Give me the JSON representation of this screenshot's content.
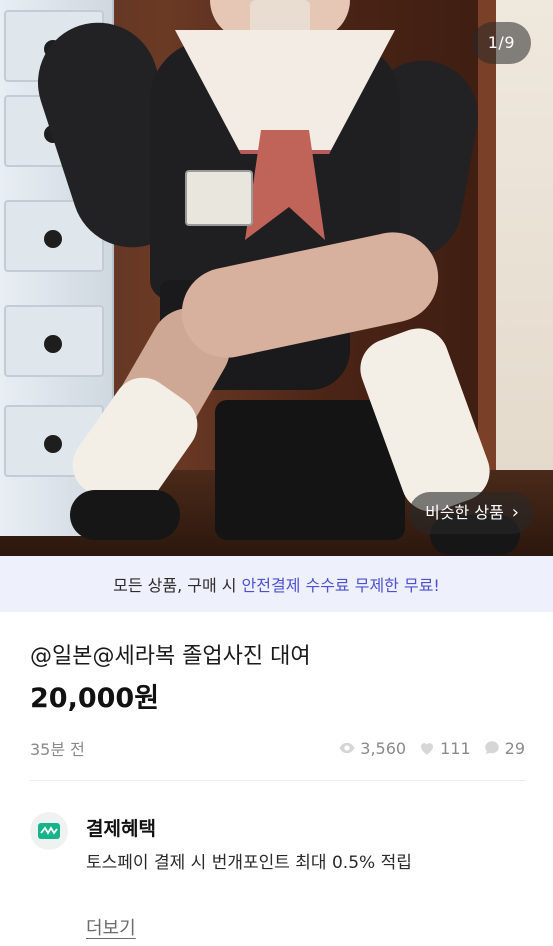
{
  "gallery": {
    "counter": "1/9",
    "similar_label": "비슷한 상품",
    "similar_chevron": "›"
  },
  "promo": {
    "prefix": "모든 상품, 구매 시",
    "highlight": "안전결제 수수료 무제한 무료!",
    "accent_color": "#4f4fd1"
  },
  "product": {
    "title": "@일본@세라복 졸업사진 대여",
    "price": "20,000원",
    "posted": "35분 전",
    "views": "3,560",
    "likes": "111",
    "chats": "29"
  },
  "benefits": {
    "title": "결제혜택",
    "description": "토스페이 결제 시 번개포인트 최대 0.5% 적립",
    "more": "더보기"
  },
  "icons": {
    "views": "eye-icon",
    "likes": "heart-icon",
    "chats": "chat-bubble-icon",
    "benefit": "pay-logo-icon"
  }
}
